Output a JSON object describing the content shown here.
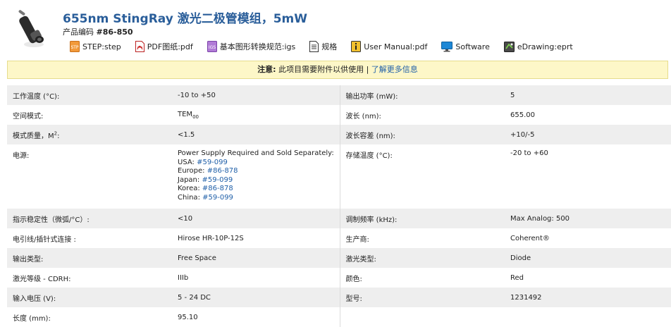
{
  "header": {
    "title": "655nm StingRay 激光二极管模组，5mW",
    "sku_label": "产品编码",
    "sku_value": "#86-850"
  },
  "downloads": [
    {
      "label": "STEP:step",
      "icon": "step-file-icon"
    },
    {
      "label": "PDF图纸:pdf",
      "icon": "pdf-file-icon"
    },
    {
      "label": "基本图形转换规范:igs",
      "icon": "igs-file-icon"
    },
    {
      "label": "规格",
      "icon": "document-icon"
    },
    {
      "label": "User Manual:pdf",
      "icon": "manual-icon"
    },
    {
      "label": "Software",
      "icon": "monitor-icon"
    },
    {
      "label": "eDrawing:eprt",
      "icon": "edrawing-icon"
    }
  ],
  "notice": {
    "bold": "注意:",
    "text": "此项目需要附件以供使用 |",
    "link": "了解更多信息"
  },
  "specs": {
    "rows": [
      {
        "l1": "工作温度 (°C):",
        "v1": "-10 to +50",
        "l2": "输出功率 (mW):",
        "v2": "5"
      },
      {
        "l1": "空间模式:",
        "v1": "TEM",
        "v1_sub": "00",
        "l2": "波长 (nm):",
        "v2": "655.00"
      },
      {
        "l1": "模式质量，M",
        "l1_sup": "2",
        "l1_suffix": ":",
        "v1": "<1.5",
        "l2": "波长容差 (nm):",
        "v2": "+10/-5"
      },
      {
        "l1": "电源:",
        "l2": "存储温度 (°C):",
        "v2": "-20 to +60"
      },
      {
        "l1": "指示稳定性（微弧/°C）:",
        "v1": "<10",
        "l2": "调制频率 (kHz):",
        "v2": "Max Analog: 500"
      },
      {
        "l1": "电引线/插针式连接 :",
        "v1": "Hirose HR-10P-12S",
        "l2": "生产商:",
        "v2": "Coherent®"
      },
      {
        "l1": "输出类型:",
        "v1": "Free Space",
        "l2": "激光类型:",
        "v2": "Diode"
      },
      {
        "l1": "激光等级 - CDRH:",
        "v1": "IIIb",
        "l2": "颜色:",
        "v2": "Red"
      },
      {
        "l1": "输入电压 (V):",
        "v1": "5 - 24 DC",
        "l2": "型号:",
        "v2": "1231492"
      },
      {
        "l1": "长度 (mm):",
        "v1": "95.10"
      }
    ],
    "power": {
      "intro": "Power Supply Required and Sold Separately:",
      "items": [
        {
          "region": "USA:",
          "part": "#59-099"
        },
        {
          "region": "Europe:",
          "part": "#86-878"
        },
        {
          "region": "Japan:",
          "part": "#59-099"
        },
        {
          "region": "Korea:",
          "part": "#86-878"
        },
        {
          "region": "China:",
          "part": "#59-099"
        }
      ]
    }
  }
}
